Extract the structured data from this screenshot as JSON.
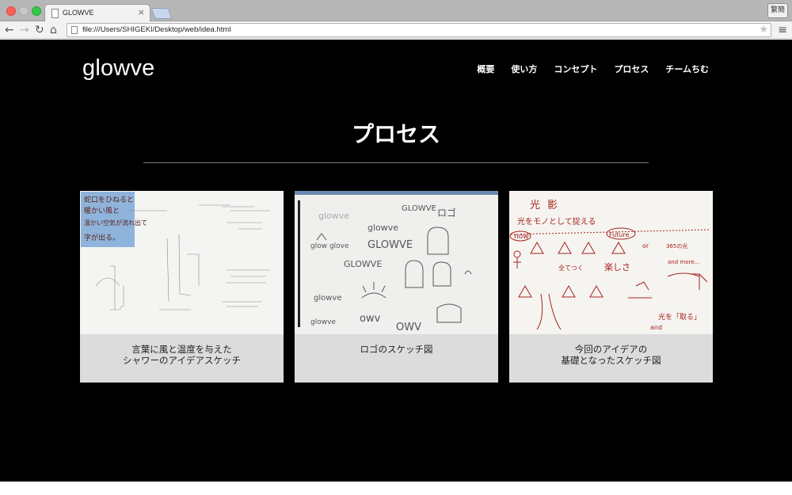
{
  "browser": {
    "tab_title": "GLOWVE",
    "tab_close": "×",
    "lang_button": "繁簡",
    "url": "file:///Users/SHIGEKI/Desktop/web/idea.html",
    "icons": {
      "back": "←",
      "forward": "→",
      "reload": "↻",
      "home": "⌂",
      "star": "★",
      "menu": "≡"
    }
  },
  "site": {
    "logo": "glowve",
    "nav": [
      "概要",
      "使い方",
      "コンセプト",
      "プロセス",
      "チームちむ"
    ],
    "section_title": "プロセス",
    "cards": [
      {
        "caption_line1": "言葉に風と温度を与えた",
        "caption_line2": "シャワーのアイデアスケッチ",
        "image": "shower-idea-sketch"
      },
      {
        "caption_line1": "ロゴのスケッチ図",
        "caption_line2": "",
        "image": "logo-sketch"
      },
      {
        "caption_line1": "今回のアイデアの",
        "caption_line2": "基礎となったスケッチ図",
        "image": "base-idea-sketch"
      }
    ],
    "sketch_text": {
      "card1_note": [
        "蛇口をひねると",
        "暖かい風と",
        "温かい空気が流れ出て",
        "字が出る。"
      ],
      "card2_words": [
        "GLOWVE",
        "glowve",
        "ロゴ",
        "glow glove",
        "GLOWVE",
        "glowve",
        "GLOWVE",
        "glowve",
        "owv",
        "ОWV",
        "glowve"
      ],
      "card3_words": [
        "光",
        "影",
        "光をモノとして捉える",
        "now",
        "Future",
        "365の光",
        "or",
        "and more...",
        "全てつく",
        "楽しさ",
        "光を「取る」",
        "and"
      ]
    }
  },
  "colors": {
    "page_bg": "#000000",
    "text": "#ffffff",
    "card_bg": "#dcdcdc",
    "sketch_red": "#a8231c",
    "note_blue": "#7aa6d6"
  }
}
